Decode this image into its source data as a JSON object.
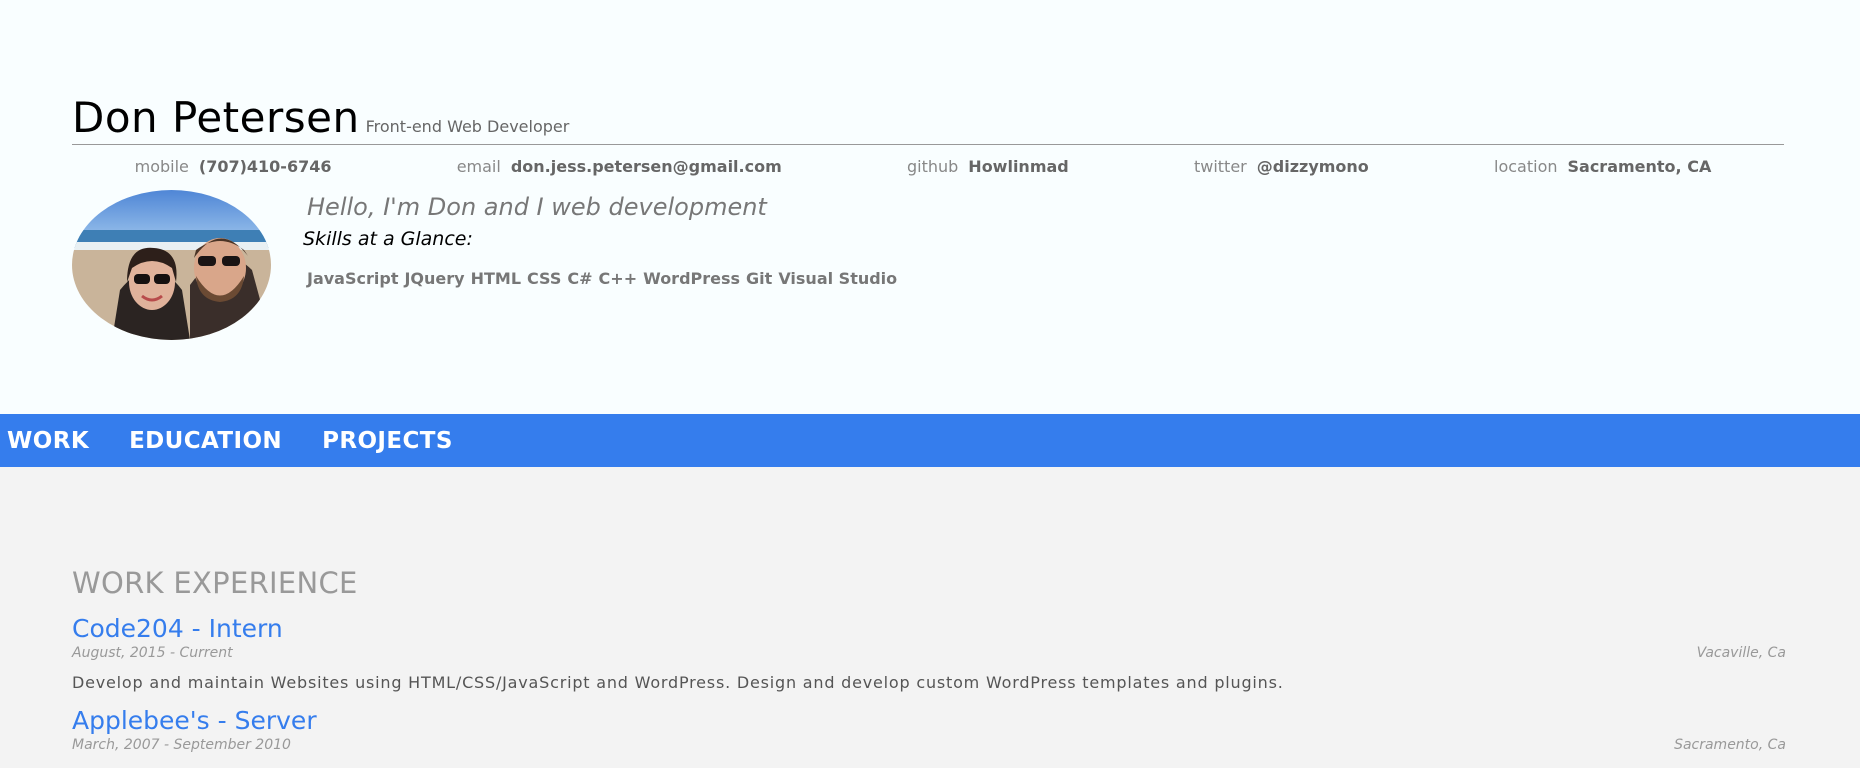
{
  "header": {
    "name": "Don Petersen",
    "role": "Front-end Web Developer",
    "contacts": [
      {
        "label": "mobile",
        "value": "(707)410-6746"
      },
      {
        "label": "email",
        "value": "don.jess.petersen@gmail.com"
      },
      {
        "label": "github",
        "value": "Howlinmad"
      },
      {
        "label": "twitter",
        "value": "@dizzymono"
      },
      {
        "label": "location",
        "value": "Sacramento, CA"
      }
    ],
    "welcome": "Hello, I'm Don and I web development",
    "skills_heading": "Skills at a Glance:",
    "skills": [
      "JavaScript",
      "JQuery",
      "HTML",
      "CSS",
      "C#",
      "C++",
      "WordPress",
      "Git",
      "Visual Studio"
    ]
  },
  "nav": {
    "items": [
      "WORK",
      "EDUCATION",
      "PROJECTS"
    ]
  },
  "work": {
    "title": "WORK EXPERIENCE",
    "jobs": [
      {
        "title": "Code204 - Intern",
        "dates": "August, 2015 - Current",
        "location": "Vacaville, Ca",
        "description": "Develop and maintain Websites using HTML/CSS/JavaScript and WordPress. Design and develop custom WordPress templates and plugins."
      },
      {
        "title": "Applebee's - Server",
        "dates": "March, 2007 - September 2010",
        "location": "Sacramento, Ca",
        "description": ""
      }
    ]
  },
  "colors": {
    "accent": "#357ded",
    "header_bg": "#f9feff",
    "body_bg": "#f3f3f3"
  }
}
